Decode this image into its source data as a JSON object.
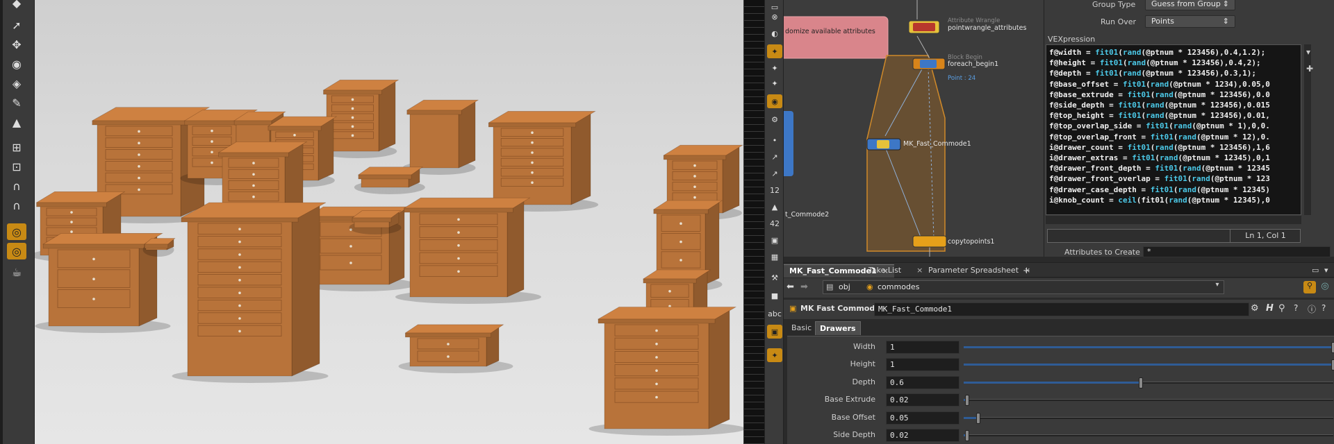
{
  "network": {
    "pink_node_label": "domize available attributes",
    "wrangle_type": "Attribute Wrangle",
    "wrangle_name": "pointwrangle_attributes",
    "block_type": "Block Begin",
    "block_name": "foreach_begin1",
    "block_info": "Point : 24",
    "commode_name": "MK_Fast_Commode1",
    "commode2_name": "t_Commode2",
    "copy_name": "copytopoints1"
  },
  "params_top": {
    "group_type_label": "Group Type",
    "group_type_value": "Guess from Group",
    "run_over_label": "Run Over",
    "run_over_value": "Points",
    "vex_label": "VEXpression",
    "status": "Ln 1, Col 1",
    "attrs_label": "Attributes to Create",
    "attrs_value": "*"
  },
  "vex_lines": [
    [
      "f@width = ",
      "fit01",
      "(",
      "rand",
      "(@ptnum * 123456),0.4,1.2);"
    ],
    [
      "f@height = ",
      "fit01",
      "(",
      "rand",
      "(@ptnum * 123456),0.4,2);"
    ],
    [
      "f@depth = ",
      "fit01",
      "(",
      "rand",
      "(@ptnum * 123456),0.3,1);"
    ],
    [
      "f@base_offset = ",
      "fit01",
      "(",
      "rand",
      "(@ptnum * 1234),0.05,0"
    ],
    [
      "f@base_extrude = ",
      "fit01",
      "(",
      "rand",
      "(@ptnum * 123456),0.0"
    ],
    [
      "f@side_depth = ",
      "fit01",
      "(",
      "rand",
      "(@ptnum * 123456),0.015"
    ],
    [
      "f@top_height = ",
      "fit01",
      "(",
      "rand",
      "(@ptnum * 123456),0.01,"
    ],
    [
      "f@top_overlap_side = ",
      "fit01",
      "(",
      "rand",
      "(@ptnum * 1),0,0."
    ],
    [
      "f@top_overlap_front = ",
      "fit01",
      "(",
      "rand",
      "(@ptnum * 12),0."
    ],
    [
      "i@drawer_count = ",
      "fit01",
      "(",
      "rand",
      "(@ptnum * 123456),1,6"
    ],
    [
      "i@drawer_extras = ",
      "fit01",
      "(",
      "rand",
      "(@ptnum * 12345),0,1"
    ],
    [
      "f@drawer_front_depth = ",
      "fit01",
      "(",
      "rand",
      "(@ptnum * 12345"
    ],
    [
      "f@drawer_front_overlap = ",
      "fit01",
      "(",
      "rand",
      "(@ptnum * 123"
    ],
    [
      "f@drawer_case_depth = ",
      "fit01",
      "(",
      "rand",
      "(@ptnum * 12345)"
    ],
    [
      "i@knob_count = ",
      "ceil",
      "(fit01(",
      "rand",
      "(@ptnum * 12345),0"
    ]
  ],
  "tabs": [
    {
      "label": "MK_Fast_Commode1"
    },
    {
      "label": "Take List"
    },
    {
      "label": "Parameter Spreadsheet"
    }
  ],
  "path": {
    "obj": "obj",
    "network": "commodes"
  },
  "node_header": {
    "type_label": "MK Fast Commode",
    "name_value": "MK_Fast_Commode1"
  },
  "param_tabs": [
    {
      "label": "Basic"
    },
    {
      "label": "Drawers"
    }
  ],
  "params": [
    {
      "label": "Width",
      "value": "1",
      "fraction": 1.0
    },
    {
      "label": "Height",
      "value": "1",
      "fraction": 1.0
    },
    {
      "label": "Depth",
      "value": "0.6",
      "fraction": 0.48
    },
    {
      "label": "Base Extrude",
      "value": "0.02",
      "fraction": 0.01
    },
    {
      "label": "Base Offset",
      "value": "0.05",
      "fraction": 0.04
    },
    {
      "label": "Side Depth",
      "value": "0.02",
      "fraction": 0.01
    }
  ],
  "shelf_labels": {
    "twelve": "12",
    "forty_two": "42",
    "abc": "abc"
  },
  "colors": {
    "accent": "#c88a14",
    "wood": "#b8733a",
    "vex_function": "#4cc9e8",
    "slider_fill": "#2f5c96"
  }
}
